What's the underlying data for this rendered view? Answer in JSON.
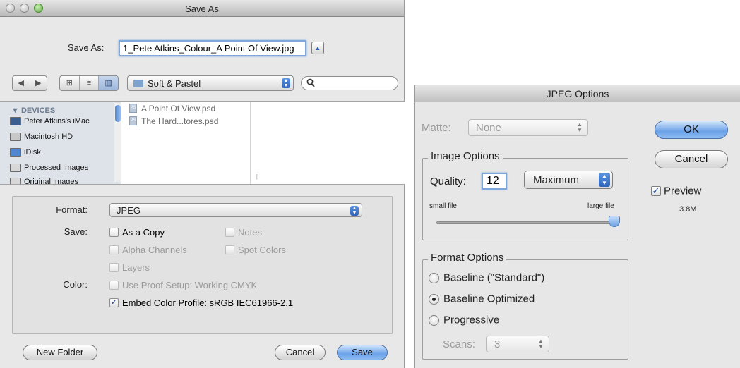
{
  "save_dialog": {
    "title": "Save As",
    "save_as_label": "Save As:",
    "filename": "1_Pete Atkins_Colour_A Point Of View.jpg",
    "expand_icon": "▲",
    "back_icon": "◀",
    "forward_icon": "▶",
    "view_icons": [
      "⊞",
      "≡",
      "▥"
    ],
    "location": "Soft & Pastel",
    "search_icon": "magnifier",
    "sidebar": {
      "header": "▼ DEVICES",
      "items": [
        {
          "label": "Peter Atkins's iMac",
          "icon": "imac-icon"
        },
        {
          "label": "Macintosh HD",
          "icon": "hard-disk-icon"
        },
        {
          "label": "iDisk",
          "icon": "idisk-icon"
        },
        {
          "label": "Processed Images",
          "icon": "disk-icon"
        },
        {
          "label": "Original Images",
          "icon": "disk-icon"
        }
      ]
    },
    "files": [
      "A Point Of View.psd",
      "The Hard...tores.psd"
    ],
    "format_label": "Format:",
    "format_value": "JPEG",
    "save_label": "Save:",
    "color_label": "Color:",
    "options": {
      "as_a_copy": {
        "label": "As a Copy",
        "checked": false,
        "enabled": true
      },
      "notes": {
        "label": "Notes",
        "checked": false,
        "enabled": false
      },
      "alpha_channels": {
        "label": "Alpha Channels",
        "checked": false,
        "enabled": false
      },
      "spot_colors": {
        "label": "Spot Colors",
        "checked": false,
        "enabled": false
      },
      "layers": {
        "label": "Layers",
        "checked": false,
        "enabled": false
      },
      "use_proof_setup": {
        "label": "Use Proof Setup:  Working CMYK",
        "checked": false,
        "enabled": false
      },
      "embed_color_profile": {
        "label": "Embed Color Profile:  sRGB IEC61966-2.1",
        "checked": true,
        "enabled": true
      }
    },
    "buttons": {
      "new_folder": "New Folder",
      "cancel": "Cancel",
      "save": "Save"
    }
  },
  "jpeg_dialog": {
    "title": "JPEG Options",
    "matte_label": "Matte:",
    "matte_value": "None",
    "image_options_title": "Image Options",
    "quality_label": "Quality:",
    "quality_value": "12",
    "quality_preset": "Maximum",
    "small_file": "small file",
    "large_file": "large file",
    "quality_slider_fraction": 1.0,
    "format_options_title": "Format Options",
    "formats": [
      {
        "label": "Baseline (\"Standard\")",
        "selected": false
      },
      {
        "label": "Baseline Optimized",
        "selected": true
      },
      {
        "label": "Progressive",
        "selected": false
      }
    ],
    "scans_label": "Scans:",
    "scans_value": "3",
    "ok": "OK",
    "cancel": "Cancel",
    "preview_label": "Preview",
    "preview_checked": true,
    "file_size": "3.8M"
  },
  "colors": {
    "accent_blue": "#6ba3ea",
    "dialog_bg": "#e8e8e8",
    "sidebar_bg": "#dee3ea",
    "disabled_text": "#9b9b9b"
  }
}
